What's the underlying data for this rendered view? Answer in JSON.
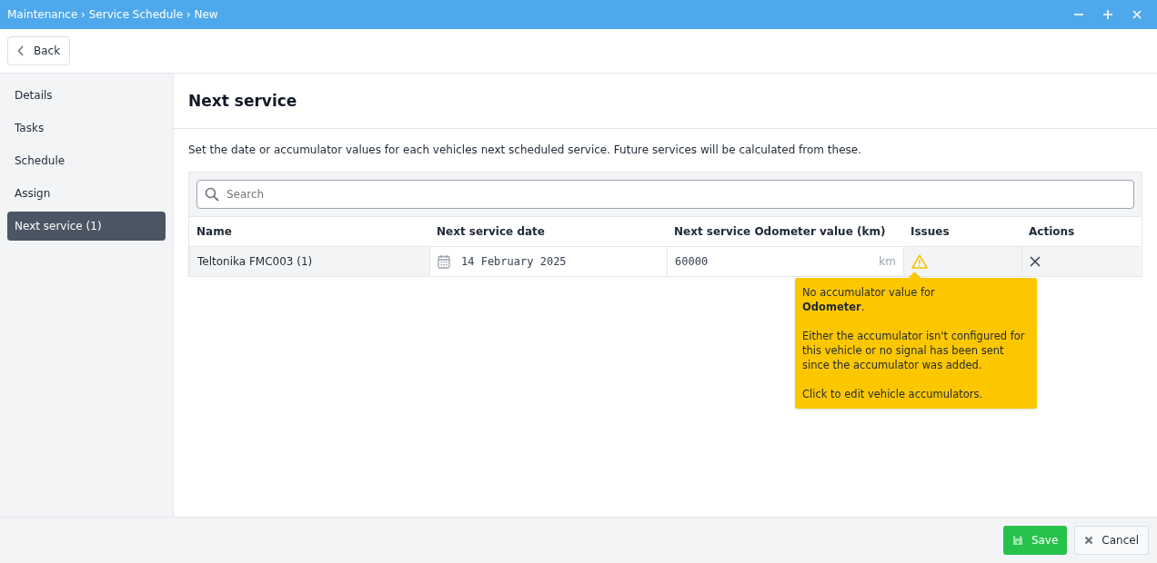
{
  "window": {
    "breadcrumb": "Maintenance › Service Schedule › New"
  },
  "toolbar": {
    "back_label": "Back"
  },
  "sidebar": {
    "items": [
      {
        "label": "Details",
        "selected": false
      },
      {
        "label": "Tasks",
        "selected": false
      },
      {
        "label": "Schedule",
        "selected": false
      },
      {
        "label": "Assign",
        "selected": false
      },
      {
        "label": "Next service (1)",
        "selected": true
      }
    ]
  },
  "page": {
    "title": "Next service",
    "description": "Set the date or accumulator values for each vehicles next scheduled service. Future services will be calculated from these."
  },
  "search": {
    "placeholder": "Search"
  },
  "table": {
    "columns": [
      "Name",
      "Next service date",
      "Next service Odometer value (km)",
      "Issues",
      "Actions"
    ],
    "rows": [
      {
        "name": "Teltonika FMC003 (1)",
        "date": "14 February 2025",
        "odometer": "60000",
        "unit": "km",
        "warning": true
      }
    ]
  },
  "tooltip": {
    "paragraphs": [
      "No accumulator value for\n**Odometer**.",
      "Either the accumulator isn't configured for this vehicle or no signal has been sent since the accumulator was added.",
      "Click to edit vehicle accumulators."
    ]
  },
  "footer": {
    "save_label": "Save",
    "cancel_label": "Cancel"
  }
}
